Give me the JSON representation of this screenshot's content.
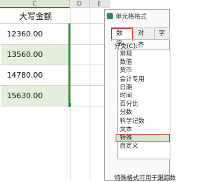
{
  "spreadsheet": {
    "columns": [
      {
        "label": "C",
        "selected": true
      },
      {
        "label": "D",
        "selected": false
      },
      {
        "label": "E",
        "selected": false
      }
    ],
    "header_cell": "大写金额",
    "cells": [
      "12360.00",
      "13560.00",
      "14780.00",
      "15630.00"
    ],
    "selection_color": "#3b8d3b"
  },
  "dialog": {
    "title": "单元格格式",
    "tabs": [
      "数字",
      "对齐",
      "字"
    ],
    "active_tab": "数字",
    "category_label": "分类(C):",
    "categories": [
      "常规",
      "数值",
      "货币",
      "会计专用",
      "日期",
      "时间",
      "百分比",
      "分数",
      "科学记数",
      "文本",
      "特殊",
      "自定义"
    ],
    "selected_category": "特殊",
    "hint": "特殊格式可用于跟踪数",
    "highlight_color": "#d23b3b"
  }
}
